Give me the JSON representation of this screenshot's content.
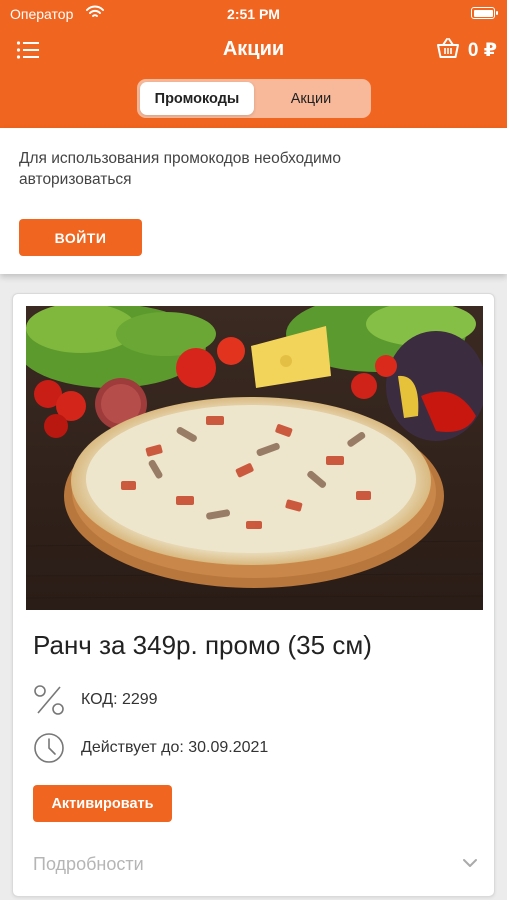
{
  "status_bar": {
    "carrier": "Оператор",
    "time": "2:51 PM"
  },
  "nav": {
    "title": "Акции",
    "cart_amount": "0 ₽"
  },
  "tabs": [
    {
      "label": "Промокоды",
      "active": true
    },
    {
      "label": "Акции",
      "active": false
    }
  ],
  "notice": {
    "text": "Для использования промокодов необходимо авторизоваться",
    "login_label": "ВОЙТИ"
  },
  "promo": {
    "title": "Ранч за 349р. промо (35 см)",
    "code_text": "КОД: 2299",
    "valid_text": "Действует до: 30.09.2021",
    "activate_label": "Активировать",
    "details_label": "Подробности"
  },
  "colors": {
    "accent": "#f0651f",
    "background": "#ececec"
  },
  "icons": [
    "wifi-icon",
    "battery-icon",
    "menu-icon",
    "basket-icon",
    "percent-icon",
    "clock-icon",
    "chevron-down-icon"
  ]
}
